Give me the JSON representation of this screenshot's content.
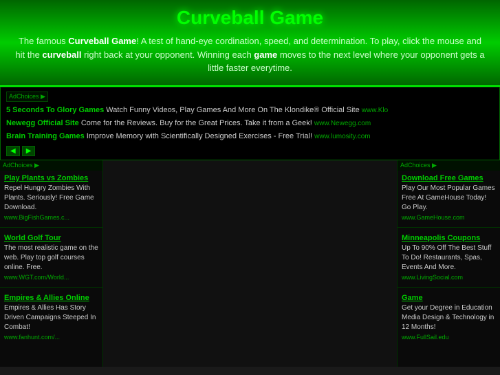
{
  "header": {
    "title": "Curveball Game",
    "description_parts": [
      "The famous ",
      "Curveball Game",
      "! A test of hand-eye cordination, speed, and determination. To play, click the mouse and hit the ",
      "curveball",
      " right back at your opponent. Winning each ",
      "game",
      " moves to the next level where your opponent gets a little faster everytime."
    ]
  },
  "ad_banner": {
    "adchoices_label": "AdChoices ▶",
    "adchoices_label_right": "AdChoices ▶",
    "items": [
      {
        "title": "5 Seconds To Glory Games",
        "text": " Watch Funny Videos, Play Games And More On The Klondike® Official Site",
        "domain": "www.Klo"
      },
      {
        "title": "Newegg Official Site",
        "text": " Come for the Reviews. Buy for the Great Prices. Take it from a Geek!",
        "domain": "www.Newegg.com"
      },
      {
        "title": "Brain Training Games",
        "text": " Improve Memory with Scientifically Designed Exercises - Free Trial!",
        "domain": "www.lumosity.com"
      }
    ],
    "prev_arrow": "◀",
    "next_arrow": "▶"
  },
  "left_sidebar": {
    "adchoices_label": "AdChoices ▶",
    "ads": [
      {
        "title": "Play Plants vs Zombies",
        "text": "Repel Hungry Zombies With Plants. Seriously! Free Game Download.",
        "domain": "www.BigFishGames.c..."
      },
      {
        "title": "World Golf Tour",
        "text": "The most realistic game on the web. Play top golf courses online. Free.",
        "domain": "www.WGT.com/World..."
      },
      {
        "title": "Empires & Allies Online",
        "text": "Empires & Allies Has Story Driven Campaigns Steeped In Combat!",
        "domain": "www.fanhunt.com/..."
      }
    ]
  },
  "right_sidebar": {
    "adchoices_label": "AdChoices ▶",
    "ads": [
      {
        "title": "Download Free Games",
        "text": "Play Our Most Popular Games Free At GameHouse Today! Go Play.",
        "domain": "www.GameHouse.com"
      },
      {
        "title": "Minneapolis Coupons",
        "text": "Up To 90% Off The Best Stuff To Do! Restaurants, Spas, Events And More.",
        "domain": "www.LivingSocial.com"
      },
      {
        "title": "Game",
        "text": "Get your Degree in Education Media Design & Technology in 12 Months!",
        "domain": "www.FullSail.edu"
      }
    ]
  }
}
